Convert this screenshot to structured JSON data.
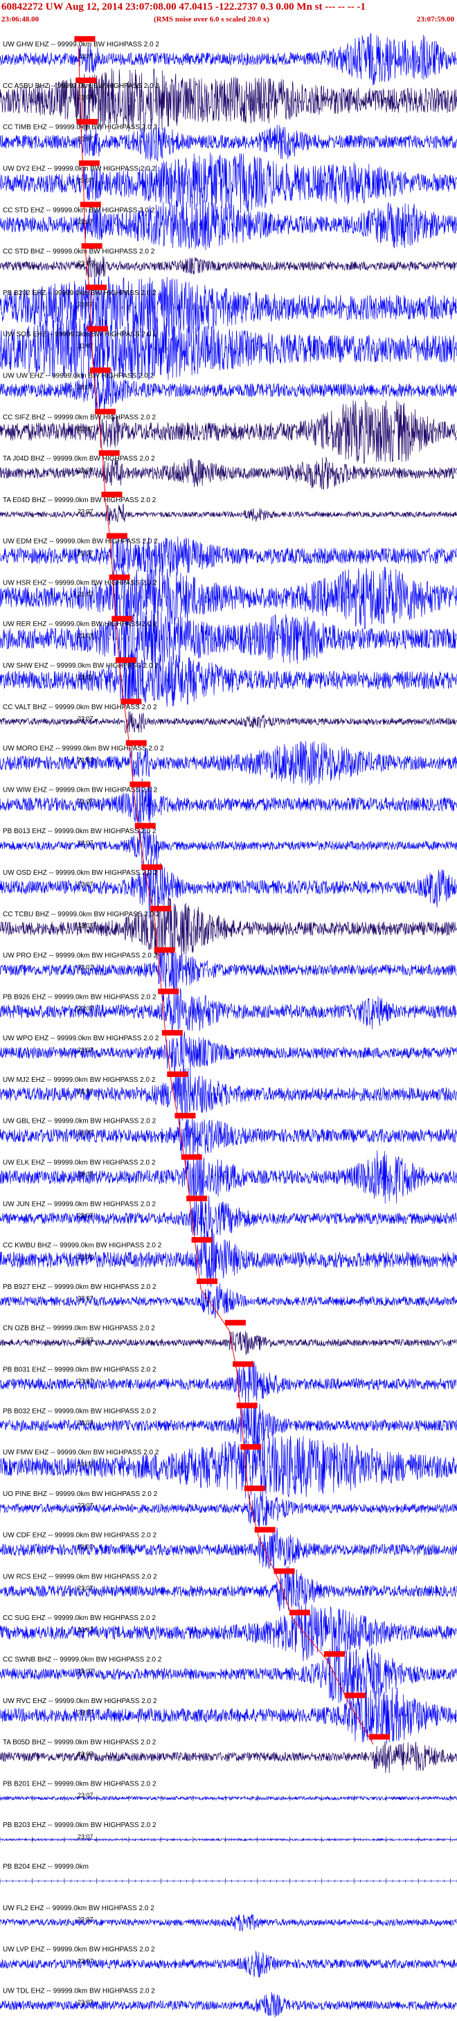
{
  "header": {
    "title": "60842272 UW Aug 12, 2014 23:07:08.00   47.0415 -122.2737  0.3 0.00 Mn st --- -- -- -1",
    "start_time": "23:06:48.00",
    "note": "(RMS noise over 6.0 s scaled 20.0 x)",
    "end_time": "23:07:59.00"
  },
  "colors": {
    "trace_blue": "#0000ff",
    "trace_dark": "#1a0066",
    "pick_red": "#ff0000",
    "text_red": "#cc0000",
    "label_black": "#000000",
    "tick_black": "#000000"
  },
  "chart_data": {
    "type": "line",
    "title": "60842272 UW Aug 12, 2014 23:07:08.00   47.0415 -122.2737  0.3 0.00 Mn st --- -- -- -1",
    "time_axis": {
      "start": "23:06:48.00",
      "end": "23:07:59.00",
      "pick_label": "23:07"
    },
    "note": "(RMS noise over 6.0 s scaled 20.0 x)",
    "grid": false,
    "legend": "none",
    "traces": [
      {
        "label": "UW GHW EHZ -- 99999.0km BW  HIGHPASS  2.0  2",
        "tag": "23:07",
        "pick_s": 12.2,
        "dark": false,
        "amp": 0.28,
        "bursts": [
          [
            58,
            5,
            0.9
          ],
          [
            66,
            3,
            0.7
          ]
        ]
      },
      {
        "label": "CC ASBU BHZ -- 99999.0km BW  HIGHPASS  2.0  2",
        "tag": "23:07",
        "pick_s": 12.4,
        "dark": true,
        "amp": 0.55,
        "bursts": [
          [
            20,
            10,
            1.0
          ],
          [
            40,
            8,
            0.5
          ]
        ]
      },
      {
        "label": "CC TIMB EHZ -- 99999.0km BW  HIGHPASS  2.0  2",
        "tag": "23:07",
        "pick_s": 12.6,
        "dark": false,
        "amp": 0.3,
        "bursts": [
          [
            24,
            3,
            0.6
          ],
          [
            44,
            3,
            0.5
          ]
        ]
      },
      {
        "label": "UW DY2 EHZ -- 99999.0km BW  HIGHPASS  2.0  2",
        "tag": "23:07",
        "pick_s": 12.9,
        "dark": false,
        "amp": 0.4,
        "bursts": [
          [
            34,
            12,
            1.0
          ],
          [
            55,
            6,
            0.5
          ]
        ]
      },
      {
        "label": "CC STD EHZ -- 99999.0km BW  HIGHPASS  2.0  2",
        "tag": "23:07",
        "pick_s": 13.1,
        "dark": false,
        "amp": 0.35,
        "bursts": [
          [
            30,
            10,
            0.8
          ],
          [
            62,
            5,
            0.7
          ]
        ]
      },
      {
        "label": "CC STD BHZ -- 99999.0km BW  HIGHPASS  2.0  2",
        "tag": "23:07",
        "pick_s": 13.3,
        "dark": true,
        "amp": 0.2,
        "bursts": [
          [
            30,
            2,
            0.2
          ]
        ]
      },
      {
        "label": "PB B202 EHZ -- 99999.0km BW  HIGHPASS  2.0  2",
        "tag": "23:07",
        "pick_s": 14.0,
        "dark": false,
        "amp": 0.55,
        "bursts": [
          [
            20,
            14,
            1.0
          ]
        ]
      },
      {
        "label": "UW SOS EHZ -- 99999.0km BW  HIGHPASS  2.0  2",
        "tag": "23:07",
        "pick_s": 14.2,
        "dark": false,
        "amp": 0.6,
        "bursts": [
          [
            18,
            16,
            1.0
          ]
        ]
      },
      {
        "label": "UW UW EHZ -- 99999.0km BW  HIGHPASS  2.0  2",
        "tag": "23:07",
        "pick_s": 14.6,
        "dark": false,
        "amp": 0.3,
        "bursts": [
          [
            16,
            4,
            0.4
          ]
        ]
      },
      {
        "label": "CC SIFZ BHZ -- 99999.0km BW  HIGHPASS  2.0  2",
        "tag": "23:07",
        "pick_s": 15.4,
        "dark": true,
        "amp": 0.4,
        "bursts": [
          [
            56,
            6,
            1.0
          ],
          [
            62,
            4,
            0.8
          ]
        ]
      },
      {
        "label": "TA J04D BHZ -- 99999.0km BW  HIGHPASS  2.0  2",
        "tag": "23:07",
        "pick_s": 16.0,
        "dark": true,
        "amp": 0.25,
        "bursts": [
          [
            30,
            4,
            0.4
          ],
          [
            50,
            4,
            0.5
          ]
        ]
      },
      {
        "label": "TA E04D BHZ -- 99999.0km BW  HIGHPASS  2.0  2",
        "tag": "23:07",
        "pick_s": 16.4,
        "dark": true,
        "amp": 0.12,
        "bursts": [
          [
            40,
            2,
            0.2
          ]
        ]
      },
      {
        "label": "UW EDM EHZ -- 99999.0km BW  HIGHPASS  2.0  2",
        "tag": "23:07",
        "pick_s": 17.2,
        "dark": false,
        "amp": 0.35,
        "bursts": [
          [
            26,
            6,
            0.6
          ]
        ]
      },
      {
        "label": "UW HSR EHZ -- 99999.0km BW  HIGHPASS  2.0  2",
        "tag": "23:07",
        "pick_s": 17.6,
        "dark": false,
        "amp": 0.45,
        "bursts": [
          [
            24,
            8,
            0.9
          ],
          [
            58,
            8,
            1.0
          ]
        ]
      },
      {
        "label": "UW RER EHZ -- 99999.0km BW  HIGHPASS  2.0  2",
        "tag": "23:07",
        "pick_s": 18.0,
        "dark": false,
        "amp": 0.45,
        "bursts": [
          [
            24,
            8,
            0.9
          ],
          [
            45,
            6,
            0.7
          ]
        ]
      },
      {
        "label": "UW SHW EHZ -- 99999.0km BW  HIGHPASS  2.0  2",
        "tag": "23:07",
        "pick_s": 18.6,
        "dark": false,
        "amp": 0.4,
        "bursts": [
          [
            26,
            8,
            0.8
          ]
        ]
      },
      {
        "label": "CC VALT BHZ -- 99999.0km BW  HIGHPASS  2.0  2",
        "tag": "23:07",
        "pick_s": 19.4,
        "dark": true,
        "amp": 0.15,
        "bursts": [
          [
            40,
            2,
            0.2
          ]
        ]
      },
      {
        "label": "UW MORO EHZ -- 99999.0km BW  HIGHPASS  2.0  2",
        "tag": "23:07",
        "pick_s": 20.2,
        "dark": false,
        "amp": 0.3,
        "bursts": [
          [
            48,
            8,
            0.7
          ]
        ]
      },
      {
        "label": "UW WIW EHZ -- 99999.0km BW  HIGHPASS  2.0  2",
        "tag": "23:07",
        "pick_s": 20.8,
        "dark": false,
        "amp": 0.3,
        "bursts": [
          [
            22,
            3,
            0.5
          ]
        ]
      },
      {
        "label": "PB B013 EHZ -- 99999.0km BW  HIGHPASS  2.0  2",
        "tag": "23:07",
        "pick_s": 21.6,
        "dark": false,
        "amp": 0.2,
        "bursts": [
          [
            22,
            2,
            0.4
          ]
        ]
      },
      {
        "label": "UW OSD EHZ -- 99999.0km BW  HIGHPASS  2.0  2",
        "tag": "23:07",
        "pick_s": 22.6,
        "dark": false,
        "amp": 0.3,
        "bursts": [
          [
            24,
            3,
            0.8
          ],
          [
            68,
            2,
            0.6
          ]
        ]
      },
      {
        "label": "CC TCBU BHZ -- 99999.0km BW  HIGHPASS  2.0  2",
        "tag": "23:07",
        "pick_s": 24.0,
        "dark": true,
        "amp": 0.3,
        "bursts": [
          [
            27,
            6,
            1.0
          ]
        ]
      },
      {
        "label": "UW PRO EHZ -- 99999.0km BW  HIGHPASS  2.0  2",
        "tag": "23:07",
        "pick_s": 24.6,
        "dark": false,
        "amp": 0.25,
        "bursts": [
          [
            28,
            4,
            0.5
          ]
        ]
      },
      {
        "label": "PB B926 EHZ -- 99999.0km BW  HIGHPASS  2.0  2",
        "tag": "23:07",
        "pick_s": 25.2,
        "dark": false,
        "amp": 0.3,
        "bursts": [
          [
            30,
            4,
            0.6
          ],
          [
            58,
            2,
            0.5
          ]
        ]
      },
      {
        "label": "UW WPO EHZ -- 99999.0km BW  HIGHPASS  2.0  2",
        "tag": "23:07",
        "pick_s": 25.8,
        "dark": false,
        "amp": 0.25,
        "bursts": [
          [
            30,
            4,
            0.5
          ]
        ]
      },
      {
        "label": "UW MJ2 EHZ -- 99999.0km BW  HIGHPASS  2.0  2",
        "tag": "23:07",
        "pick_s": 26.6,
        "dark": false,
        "amp": 0.3,
        "bursts": [
          [
            30,
            5,
            0.6
          ]
        ]
      },
      {
        "label": "UW GBL EHZ -- 99999.0km BW  HIGHPASS  2.0  2",
        "tag": "23:07",
        "pick_s": 27.8,
        "dark": false,
        "amp": 0.3,
        "bursts": [
          [
            32,
            4,
            0.5
          ]
        ]
      },
      {
        "label": "UW ELK EHZ -- 99999.0km BW  HIGHPASS  2.0  2",
        "tag": "23:07",
        "pick_s": 28.8,
        "dark": false,
        "amp": 0.3,
        "bursts": [
          [
            33,
            4,
            0.6
          ],
          [
            60,
            4,
            1.0
          ]
        ]
      },
      {
        "label": "UW JUN EHZ -- 99999.0km BW  HIGHPASS  2.0  2",
        "tag": "23:07",
        "pick_s": 29.6,
        "dark": false,
        "amp": 0.25,
        "bursts": [
          [
            34,
            4,
            0.5
          ]
        ]
      },
      {
        "label": "CC KWBU BHZ -- 99999.0km BW  HIGHPASS  2.0  2",
        "tag": "23:07",
        "pick_s": 30.4,
        "dark": false,
        "amp": 0.35,
        "bursts": [
          [
            34,
            3,
            0.7
          ]
        ]
      },
      {
        "label": "PB B927 EHZ -- 99999.0km BW  HIGHPASS  2.0  2",
        "tag": "23:07",
        "pick_s": 31.2,
        "dark": false,
        "amp": 0.2,
        "bursts": [
          [
            35,
            2,
            0.4
          ]
        ]
      },
      {
        "label": "CN OZB BHZ -- 99999.0km BW  HIGHPASS  2.0  2",
        "tag": "23:07",
        "pick_s": 35.6,
        "dark": true,
        "amp": 0.15,
        "bursts": [
          [
            40,
            2,
            0.2
          ]
        ]
      },
      {
        "label": "PB B031 EHZ -- 99999.0km BW  HIGHPASS  2.0  2",
        "tag": "23:07",
        "pick_s": 36.8,
        "dark": false,
        "amp": 0.25,
        "bursts": [
          [
            40,
            3,
            0.5
          ]
        ]
      },
      {
        "label": "PB B032 EHZ -- 99999.0km BW  HIGHPASS  2.0  2",
        "tag": "23:07",
        "pick_s": 37.4,
        "dark": false,
        "amp": 0.25,
        "bursts": [
          [
            40,
            3,
            0.5
          ]
        ]
      },
      {
        "label": "UW FMW EHZ -- 99999.0km BW  HIGHPASS  2.0  2",
        "tag": "23:07",
        "pick_s": 38.0,
        "dark": false,
        "amp": 0.4,
        "bursts": [
          [
            44,
            16,
            1.0
          ]
        ]
      },
      {
        "label": "UO PINE BHZ -- 99999.0km BW  HIGHPASS  2.0  2",
        "tag": "23:07",
        "pick_s": 38.6,
        "dark": false,
        "amp": 0.2,
        "bursts": [
          [
            42,
            3,
            0.4
          ]
        ]
      },
      {
        "label": "UW CDF EHZ -- 99999.0km BW  HIGHPASS  2.0  2",
        "tag": "23:07",
        "pick_s": 40.2,
        "dark": false,
        "amp": 0.25,
        "bursts": [
          [
            44,
            3,
            0.5
          ]
        ]
      },
      {
        "label": "UW RCS EHZ -- 99999.0km BW  HIGHPASS  2.0  2",
        "tag": "23:07",
        "pick_s": 43.2,
        "dark": false,
        "amp": 0.25,
        "bursts": [
          [
            46,
            3,
            0.6
          ]
        ]
      },
      {
        "label": "CC SUG EHZ -- 99999.0km BW  HIGHPASS  2.0  2",
        "tag": "23:07",
        "pick_s": 45.6,
        "dark": false,
        "amp": 0.3,
        "bursts": [
          [
            50,
            8,
            0.9
          ]
        ]
      },
      {
        "label": "CC SWNB BHZ -- 99999.0km BW  HIGHPASS  2.0  2",
        "tag": "23:07",
        "pick_s": 51.0,
        "dark": false,
        "amp": 0.25,
        "bursts": [
          [
            56,
            6,
            1.0
          ]
        ]
      },
      {
        "label": "UW RVC EHZ -- 99999.0km BW  HIGHPASS  2.0  2",
        "tag": "23:07",
        "pick_s": 54.2,
        "dark": false,
        "amp": 0.3,
        "bursts": [
          [
            60,
            6,
            1.0
          ]
        ]
      },
      {
        "label": "TA B05D BHZ -- 99999.0km BW  HIGHPASS  2.0  2",
        "tag": "23:07",
        "pick_s": 58.0,
        "dark": true,
        "amp": 0.2,
        "bursts": [
          [
            64,
            4,
            0.5
          ]
        ]
      },
      {
        "label": "PB B201 EHZ -- 99999.0km BW  HIGHPASS  2.0  2",
        "tag": "23:07",
        "pick_s": 0,
        "dark": false,
        "amp": 0.08,
        "bursts": []
      },
      {
        "label": "PB B203 EHZ -- 99999.0km BW  HIGHPASS  2.0  2",
        "tag": "23:07",
        "pick_s": 0,
        "dark": false,
        "amp": 0.04,
        "bursts": []
      },
      {
        "label": "PB B204 EHZ -- 99999.0km",
        "tag": "",
        "pick_s": 0,
        "dark": false,
        "amp": 0.0,
        "bursts": []
      },
      {
        "label": "UW FL2 EHZ -- 99999.0km BW  HIGHPASS  2.0  2",
        "tag": "23:07",
        "pick_s": 0,
        "dark": false,
        "amp": 0.15,
        "bursts": [
          [
            38,
            2,
            0.3
          ]
        ]
      },
      {
        "label": "UW LVP EHZ -- 99999.0km BW  HIGHPASS  2.0  2",
        "tag": "23:07",
        "pick_s": 0,
        "dark": false,
        "amp": 0.2,
        "bursts": [
          [
            40,
            2,
            0.4
          ]
        ]
      },
      {
        "label": "UW TDL EHZ -- 99999.0km BW  HIGHPASS  2.0  2",
        "tag": "23:07",
        "pick_s": 0,
        "dark": false,
        "amp": 0.2,
        "bursts": [
          [
            42,
            2,
            0.4
          ]
        ]
      }
    ]
  }
}
